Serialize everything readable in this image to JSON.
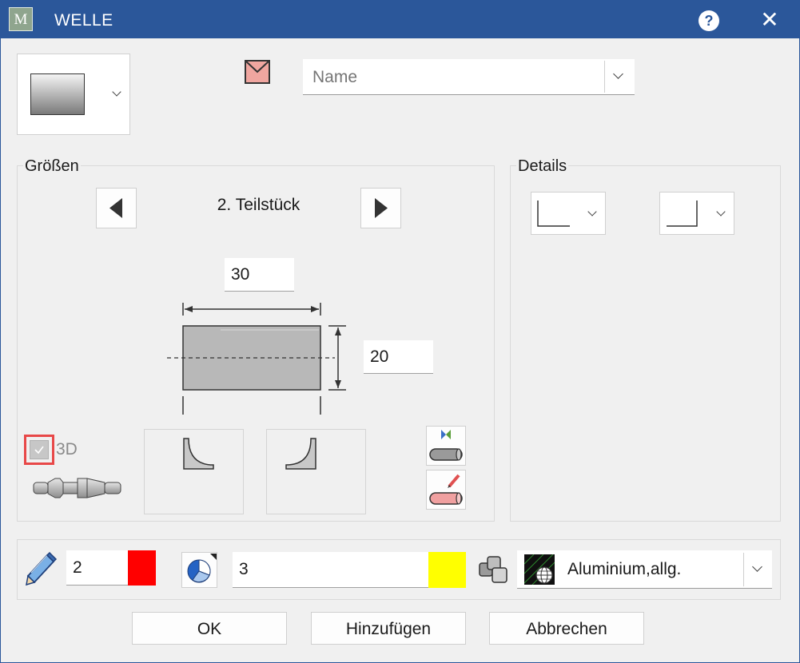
{
  "window": {
    "title": "WELLE",
    "app_icon_letter": "M",
    "help_symbol": "?",
    "close_symbol": "✕"
  },
  "top": {
    "name_placeholder": "Name"
  },
  "sizes": {
    "group_label": "Größen",
    "segment_label": "2. Teilstück",
    "length_value": "30",
    "diameter_value": "20",
    "checkbox_3d_label": "3D",
    "checkbox_3d_checked": true
  },
  "details": {
    "group_label": "Details"
  },
  "properties": {
    "pen_value": "2",
    "pen_color": "#ff0000",
    "line_value": "3",
    "line_color": "#ffff00",
    "material_label": "Aluminium,allg."
  },
  "buttons": {
    "ok": "OK",
    "add": "Hinzufügen",
    "cancel": "Abbrechen"
  },
  "colors": {
    "titlebar": "#2b579a",
    "envelope": "#f0a6a0"
  }
}
